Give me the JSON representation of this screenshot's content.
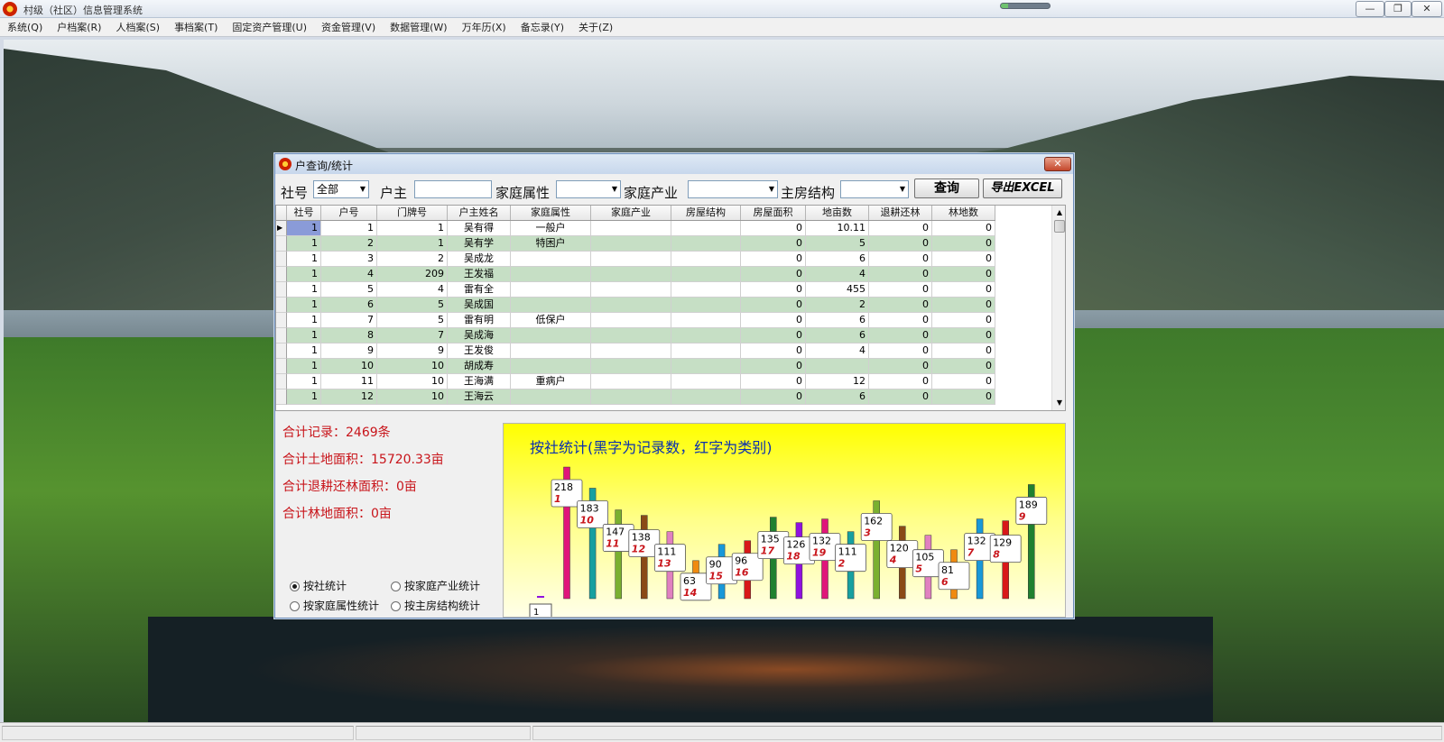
{
  "window": {
    "title": "村级（社区）信息管理系统",
    "min_label": "—",
    "max_label": "❐",
    "close_label": "✕"
  },
  "menu": [
    "系统(Q)",
    "户档案(R)",
    "人档案(S)",
    "事档案(T)",
    "固定资产管理(U)",
    "资金管理(V)",
    "数据管理(W)",
    "万年历(X)",
    "备忘录(Y)",
    "关于(Z)"
  ],
  "dialog": {
    "title": "户查询/统计",
    "close_label": "✕",
    "filters": {
      "she_label": "社号",
      "she_value": "全部",
      "owner_label": "户主",
      "owner_value": "",
      "family_attr_label": "家庭属性",
      "family_attr_value": "",
      "family_industry_label": "家庭产业",
      "family_industry_value": "",
      "house_struct_label": "主房结构",
      "house_struct_value": ""
    },
    "query_button": "查询",
    "export_button": "导出EXCEL",
    "table": {
      "columns": [
        "社号",
        "户号",
        "门牌号",
        "户主姓名",
        "家庭属性",
        "家庭产业",
        "房屋结构",
        "房屋面积",
        "地亩数",
        "退耕还林",
        "林地数"
      ],
      "rows": [
        [
          "1",
          "1",
          "1",
          "吴有得",
          "一般户",
          "",
          "",
          "0",
          "10.11",
          "0",
          "0"
        ],
        [
          "1",
          "2",
          "1",
          "吴有学",
          "特困户",
          "",
          "",
          "0",
          "5",
          "0",
          "0"
        ],
        [
          "1",
          "3",
          "2",
          "吴成龙",
          "",
          "",
          "",
          "0",
          "6",
          "0",
          "0"
        ],
        [
          "1",
          "4",
          "209",
          "王发福",
          "",
          "",
          "",
          "0",
          "4",
          "0",
          "0"
        ],
        [
          "1",
          "5",
          "4",
          "雷有全",
          "",
          "",
          "",
          "0",
          "455",
          "0",
          "0"
        ],
        [
          "1",
          "6",
          "5",
          "吴成国",
          "",
          "",
          "",
          "0",
          "2",
          "0",
          "0"
        ],
        [
          "1",
          "7",
          "5",
          "雷有明",
          "低保户",
          "",
          "",
          "0",
          "6",
          "0",
          "0"
        ],
        [
          "1",
          "8",
          "7",
          "吴成海",
          "",
          "",
          "",
          "0",
          "6",
          "0",
          "0"
        ],
        [
          "1",
          "9",
          "9",
          "王发俊",
          "",
          "",
          "",
          "0",
          "4",
          "0",
          "0"
        ],
        [
          "1",
          "10",
          "10",
          "胡成寿",
          "",
          "",
          "",
          "0",
          "",
          "0",
          "0"
        ],
        [
          "1",
          "11",
          "10",
          "王海满",
          "重病户",
          "",
          "",
          "0",
          "12",
          "0",
          "0"
        ],
        [
          "1",
          "12",
          "10",
          "王海云",
          "",
          "",
          "",
          "0",
          "6",
          "0",
          "0"
        ]
      ]
    },
    "summary": {
      "records": "合计记录：2469条",
      "land_area": "合计土地面积：15720.33亩",
      "returned_forest": "合计退耕还林面积：0亩",
      "forest_area": "合计林地面积：0亩"
    },
    "radio": {
      "by_she": "按社统计",
      "by_industry": "按家庭产业统计",
      "by_attr": "按家庭属性统计",
      "by_house": "按主房结构统计",
      "selected": "by_she"
    }
  },
  "chart_data": {
    "type": "bar",
    "title": "按社统计(黑字为记录数，红字为类别)",
    "categories": [
      "1",
      "10",
      "11",
      "12",
      "13",
      "14",
      "15",
      "16",
      "17",
      "18",
      "19",
      "2",
      "3",
      "4",
      "5",
      "6",
      "7",
      "8",
      "9"
    ],
    "values": [
      218,
      183,
      147,
      138,
      111,
      63,
      90,
      96,
      135,
      126,
      132,
      111,
      162,
      120,
      105,
      81,
      132,
      129,
      189
    ],
    "bar_colors": [
      "#e0157a",
      "#16a0a0",
      "#7ab030",
      "#8a4a16",
      "#e080c0",
      "#f08a10",
      "#1898d8",
      "#d81818",
      "#208030",
      "#9010e0",
      "#e0157a",
      "#16a0a0",
      "#7ab030",
      "#8a4a16",
      "#e080c0",
      "#f08a10",
      "#1898d8",
      "#d81818",
      "#208030"
    ],
    "value_color": "#000000",
    "category_color": "#c8141a",
    "partial_label": "1",
    "ylim": [
      0,
      230
    ]
  }
}
